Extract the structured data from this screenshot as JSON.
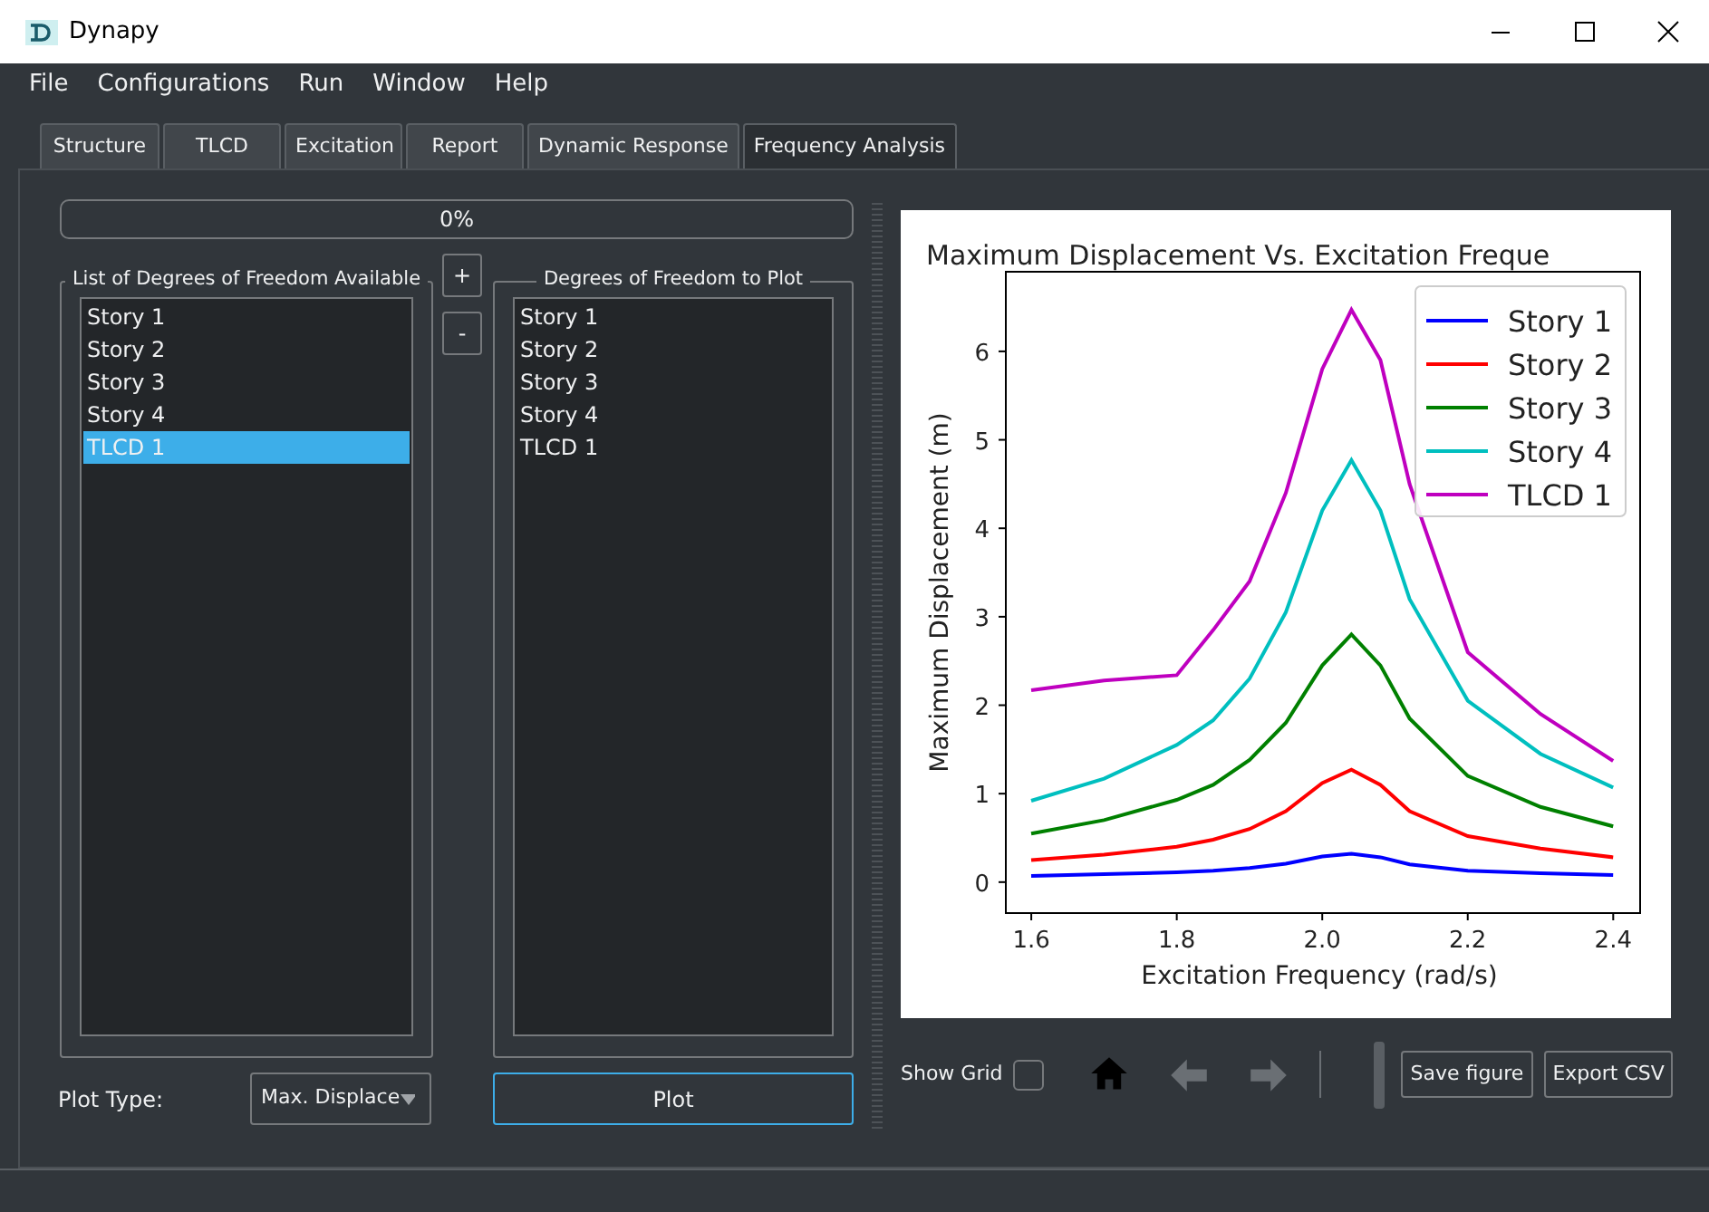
{
  "window": {
    "title": "Dynapy"
  },
  "menu": [
    "File",
    "Configurations",
    "Run",
    "Window",
    "Help"
  ],
  "tabs": [
    {
      "label": "Structure",
      "selected": false
    },
    {
      "label": "TLCD",
      "selected": false
    },
    {
      "label": "Excitation",
      "selected": false
    },
    {
      "label": "Report",
      "selected": false
    },
    {
      "label": "Dynamic Response",
      "selected": false
    },
    {
      "label": "Frequency Analysis",
      "selected": true
    }
  ],
  "progress": {
    "level": 0,
    "reading": "0%"
  },
  "available": {
    "title": "List of Degrees of Freedom Available",
    "items": [
      {
        "label": "Story 1",
        "selected": false
      },
      {
        "label": "Story 2",
        "selected": false
      },
      {
        "label": "Story 3",
        "selected": false
      },
      {
        "label": "Story 4",
        "selected": false
      },
      {
        "label": "TLCD 1",
        "selected": true
      }
    ]
  },
  "add_button": "+",
  "remove_button": "-",
  "to_plot": {
    "title": "Degrees of Freedom to Plot",
    "items": [
      {
        "label": "Story 1",
        "selected": false
      },
      {
        "label": "Story 2",
        "selected": false
      },
      {
        "label": "Story 3",
        "selected": false
      },
      {
        "label": "Story 4",
        "selected": false
      },
      {
        "label": "TLCD 1",
        "selected": false
      }
    ]
  },
  "plot_type": {
    "label": "Plot Type:",
    "value": "Max. Displace"
  },
  "plot_button": "Plot",
  "figure": {
    "chart_data": {
      "type": "line",
      "title": "Maximum Displacement Vs. Excitation Freque",
      "xlabel": "Excitation Frequency (rad/s)",
      "ylabel": "Maximum Displacement (m)",
      "x": [
        1.6,
        1.7,
        1.8,
        1.85,
        1.9,
        1.95,
        2.0,
        2.04,
        2.08,
        2.12,
        2.2,
        2.3,
        2.4
      ],
      "series": [
        {
          "name": "Story 1",
          "color": "#0000ff",
          "values": [
            0.07,
            0.09,
            0.11,
            0.13,
            0.16,
            0.21,
            0.29,
            0.32,
            0.28,
            0.2,
            0.13,
            0.1,
            0.08
          ]
        },
        {
          "name": "Story 2",
          "color": "#ff0000",
          "values": [
            0.25,
            0.31,
            0.4,
            0.48,
            0.6,
            0.8,
            1.12,
            1.27,
            1.1,
            0.8,
            0.52,
            0.38,
            0.28
          ]
        },
        {
          "name": "Story 3",
          "color": "#008000",
          "values": [
            0.55,
            0.7,
            0.93,
            1.1,
            1.38,
            1.8,
            2.45,
            2.8,
            2.45,
            1.85,
            1.2,
            0.85,
            0.63
          ]
        },
        {
          "name": "Story 4",
          "color": "#00bfbf",
          "values": [
            0.92,
            1.17,
            1.55,
            1.83,
            2.3,
            3.05,
            4.2,
            4.77,
            4.2,
            3.2,
            2.05,
            1.45,
            1.07
          ]
        },
        {
          "name": "TLCD 1",
          "color": "#bf00bf",
          "values": [
            2.17,
            2.28,
            2.34,
            2.85,
            3.4,
            4.4,
            5.8,
            6.47,
            5.9,
            4.5,
            2.6,
            1.9,
            1.37
          ]
        }
      ],
      "xlim": [
        1.565,
        2.437
      ],
      "ylim": [
        -0.35,
        6.9
      ],
      "xticks": [
        {
          "value": 1.6,
          "label": "1.6"
        },
        {
          "value": 1.8,
          "label": "1.8"
        },
        {
          "value": 2.0,
          "label": "2.0"
        },
        {
          "value": 2.2,
          "label": "2.2"
        },
        {
          "value": 2.4,
          "label": "2.4"
        }
      ],
      "yticks": [
        0,
        1,
        2,
        3,
        4,
        5,
        6
      ],
      "legend": "upper right"
    }
  },
  "toolbar": {
    "show_grid": {
      "label": "Show Grid",
      "checked": false
    },
    "navigation": [
      {
        "kind": "home",
        "disabled": false
      },
      {
        "kind": "back",
        "disabled": true
      },
      {
        "kind": "forward",
        "disabled": true
      }
    ],
    "buttons": [
      "Save figure",
      "Export CSV"
    ]
  }
}
